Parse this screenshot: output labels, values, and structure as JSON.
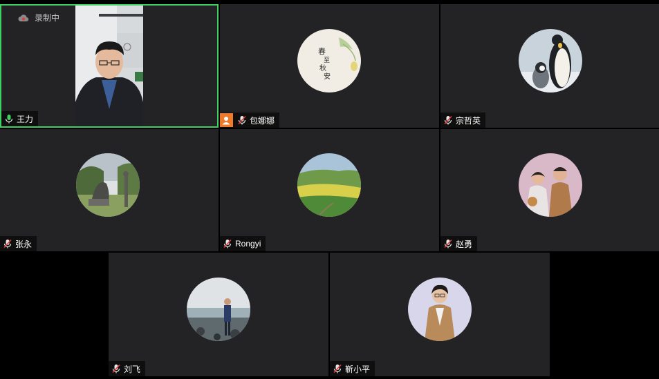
{
  "recording": {
    "label": "录制中",
    "icon": "cloud-record-icon"
  },
  "colors": {
    "background": "#000000",
    "tile": "#232325",
    "active_border": "#3fd063",
    "mic_active": "#3fd063",
    "mic_muted": "#e23b3b",
    "anon_badge": "#ef7a2a"
  },
  "participants": [
    {
      "name": "王力",
      "speaking": true,
      "mic": "mic-active-icon",
      "video_on": true,
      "active_speaker": true
    },
    {
      "name": "包娜娜",
      "speaking": false,
      "mic": "mic-muted-icon",
      "video_on": false,
      "avatar": "calligraphy-avatar",
      "badge": "person-icon"
    },
    {
      "name": "宗哲英",
      "speaking": false,
      "mic": "mic-muted-icon",
      "video_on": false,
      "avatar": "penguin-avatar"
    },
    {
      "name": "张永",
      "speaking": false,
      "mic": "mic-muted-icon",
      "video_on": false,
      "avatar": "sculpture-avatar"
    },
    {
      "name": "Rongyi",
      "speaking": false,
      "mic": "mic-muted-icon",
      "video_on": false,
      "avatar": "landscape-avatar"
    },
    {
      "name": "赵勇",
      "speaking": false,
      "mic": "mic-muted-icon",
      "video_on": false,
      "avatar": "couple-avatar"
    },
    {
      "name": "刘飞",
      "speaking": false,
      "mic": "mic-muted-icon",
      "video_on": false,
      "avatar": "beach-avatar"
    },
    {
      "name": "靳小平",
      "speaking": false,
      "mic": "mic-muted-icon",
      "video_on": false,
      "avatar": "portrait-avatar"
    }
  ]
}
